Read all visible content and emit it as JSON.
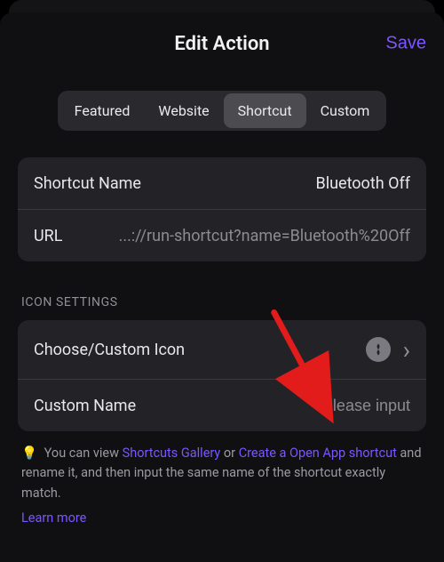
{
  "header": {
    "title": "Edit Action",
    "save_label": "Save"
  },
  "segmented": {
    "items": [
      {
        "label": "Featured",
        "active": false
      },
      {
        "label": "Website",
        "active": false
      },
      {
        "label": "Shortcut",
        "active": true
      },
      {
        "label": "Custom",
        "active": false
      }
    ]
  },
  "shortcut": {
    "name_label": "Shortcut Name",
    "name_value": "Bluetooth Off",
    "url_label": "URL",
    "url_value": "...://run-shortcut?name=Bluetooth%20Off"
  },
  "icon_settings": {
    "section_label": "ICON SETTINGS",
    "choose_label": "Choose/Custom Icon",
    "custom_name_label": "Custom Name",
    "custom_name_placeholder": "Please input"
  },
  "tip": {
    "prefix": "You can view ",
    "link1": "Shortcuts Gallery",
    "mid": " or ",
    "link2": "Create a Open App shortcut",
    "suffix": " and rename it, and then input the same name of the shortcut exactly match.",
    "learn_more": "Learn more"
  }
}
